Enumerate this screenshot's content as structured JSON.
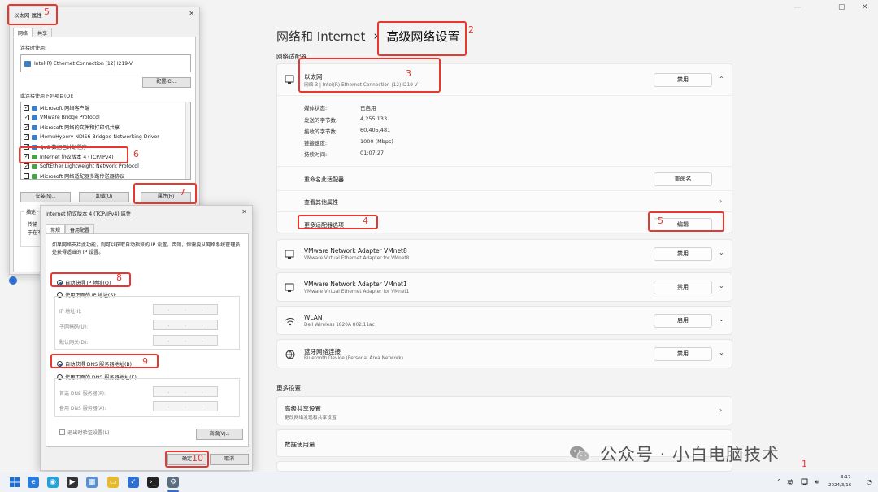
{
  "settings": {
    "window_controls": [
      "—",
      "▢",
      "✕"
    ],
    "breadcrumb": {
      "parent": "网络和 Internet",
      "separator": "›",
      "current": "高级网络设置"
    },
    "adapters_label": "网络适配器",
    "ethernet": {
      "name": "以太网",
      "desc": "网络 3 | Intel(R) Ethernet Connection (12) I219-V",
      "disable_label": "禁用",
      "details": [
        {
          "label": "媒体状态:",
          "value": "已启用"
        },
        {
          "label": "发送的字节数:",
          "value": "4,255,133"
        },
        {
          "label": "接收的字节数:",
          "value": "60,405,481"
        },
        {
          "label": "链接速度:",
          "value": "1000 (Mbps)"
        },
        {
          "label": "持续时间:",
          "value": "01:07:27"
        }
      ],
      "rename_text": "重命名此适配器",
      "rename_button": "重命名",
      "more_props": "查看其他属性",
      "more_options": "更多适配器选项",
      "edit_button": "编辑"
    },
    "adapters": [
      {
        "name": "VMware Network Adapter VMnet8",
        "desc": "VMware Virtual Ethernet Adapter for VMnet8",
        "button": "禁用"
      },
      {
        "name": "VMware Network Adapter VMnet1",
        "desc": "VMware Virtual Ethernet Adapter for VMnet1",
        "button": "禁用"
      },
      {
        "name": "WLAN",
        "desc": "Dell Wireless 1820A 802.11ac",
        "button": "启用"
      },
      {
        "name": "蓝牙网络连接",
        "desc": "Bluetooth Device (Personal Area Network)",
        "button": "禁用"
      }
    ],
    "more_settings_label": "更多设置",
    "sharing": {
      "title": "高级共享设置",
      "desc": "更改网络发现和共享设置"
    },
    "data_usage": "数据使用量"
  },
  "eth_dialog": {
    "title": "以太网 属性",
    "tabs": [
      "网络",
      "共享"
    ],
    "connect_using_label": "连接时使用:",
    "adapter_name": "Intel(R) Ethernet Connection (12) I219-V",
    "configure_button": "配置(C)...",
    "items_label": "此连接使用下列项目(O):",
    "items": [
      {
        "label": "Microsoft 网络客户端",
        "checked": true
      },
      {
        "label": "VMware Bridge Protocol",
        "checked": true
      },
      {
        "label": "Microsoft 网络的文件和打印机共享",
        "checked": true
      },
      {
        "label": "MemuHyperv NDIS6 Bridged Networking Driver",
        "checked": true
      },
      {
        "label": "QoS 数据包计划程序",
        "checked": true
      },
      {
        "label": "Internet 协议版本 4 (TCP/IPv4)",
        "checked": true
      },
      {
        "label": "SoftEther Lightweight Network Protocol",
        "checked": true
      },
      {
        "label": "Microsoft 网络适配器多路传送器协议",
        "checked": false
      }
    ],
    "install_button": "安装(N)...",
    "uninstall_button": "卸载(U)",
    "properties_button": "属性(R)",
    "desc_label": "描述",
    "desc_text_1": "传输",
    "desc_text_2": "于在不"
  },
  "ipv4_dialog": {
    "title": "Internet 协议版本 4 (TCP/IPv4) 属性",
    "tabs": [
      "常规",
      "备用配置"
    ],
    "intro": "如果网络支持此功能，则可以获取自动指派的 IP 设置。否则，你需要从网络系统管理员处获得适当的 IP 设置。",
    "auto_ip": "自动获得 IP 地址(O)",
    "manual_ip": "使用下面的 IP 地址(S):",
    "ip_label": "IP 地址(I):",
    "mask_label": "子网掩码(U):",
    "gateway_label": "默认网关(D):",
    "auto_dns": "自动获得 DNS 服务器地址(B)",
    "manual_dns": "使用下面的 DNS 服务器地址(E):",
    "pref_dns": "首选 DNS 服务器(P):",
    "alt_dns": "备用 DNS 服务器(A):",
    "validate": "退出时验证设置(L)",
    "advanced_button": "高级(V)...",
    "ok_button": "确定",
    "cancel_button": "取消"
  },
  "annotations": {
    "n1": "1",
    "n2": "2",
    "n3": "3",
    "n4": "4",
    "n5a": "5",
    "n5b": "5",
    "n6": "6",
    "n7": "7",
    "n8": "8",
    "n9": "9",
    "n10": "10"
  },
  "taskbar": {
    "time": "3:17",
    "date": "2024/3/16",
    "ime": "英"
  },
  "watermark": {
    "text": "公众号 · 小白电脑技术"
  },
  "colors": {
    "annotation": "#e8372e",
    "accent": "#0a62c4"
  }
}
